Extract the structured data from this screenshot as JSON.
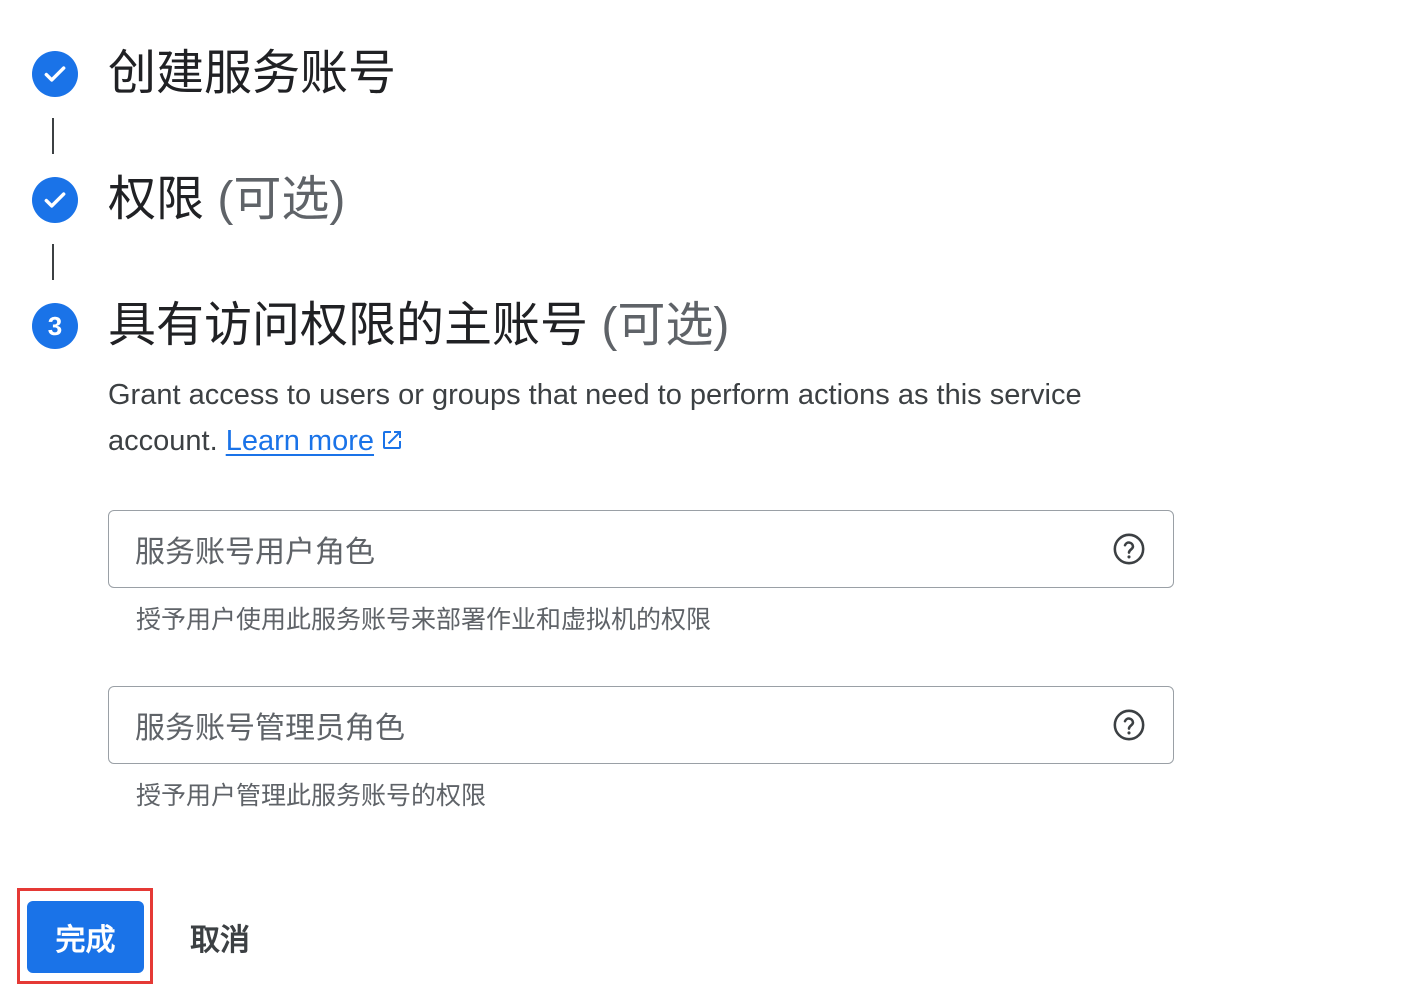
{
  "steps": [
    {
      "title": "创建服务账号",
      "optional": "",
      "state": "completed",
      "icon": "check-icon"
    },
    {
      "title": "权限",
      "optional": "(可选)",
      "state": "completed",
      "icon": "check-icon"
    },
    {
      "title": "具有访问权限的主账号",
      "optional": "(可选)",
      "state": "active",
      "number": "3"
    }
  ],
  "description": {
    "text": "Grant access to users or groups that need to perform actions as this service account.",
    "link_label": "Learn more",
    "link_icon": "open-in-new-icon"
  },
  "roles": [
    {
      "label": "服务账号用户角色",
      "hint": "授予用户使用此服务账号来部署作业和虚拟机的权限",
      "icon": "help-icon"
    },
    {
      "label": "服务账号管理员角色",
      "hint": "授予用户管理此服务账号的权限",
      "icon": "help-icon"
    }
  ],
  "actions": {
    "done_label": "完成",
    "cancel_label": "取消"
  },
  "colors": {
    "accent": "#1a73e8",
    "highlight_border": "#e53935",
    "text_primary": "#202124",
    "text_secondary": "#5f6368"
  }
}
